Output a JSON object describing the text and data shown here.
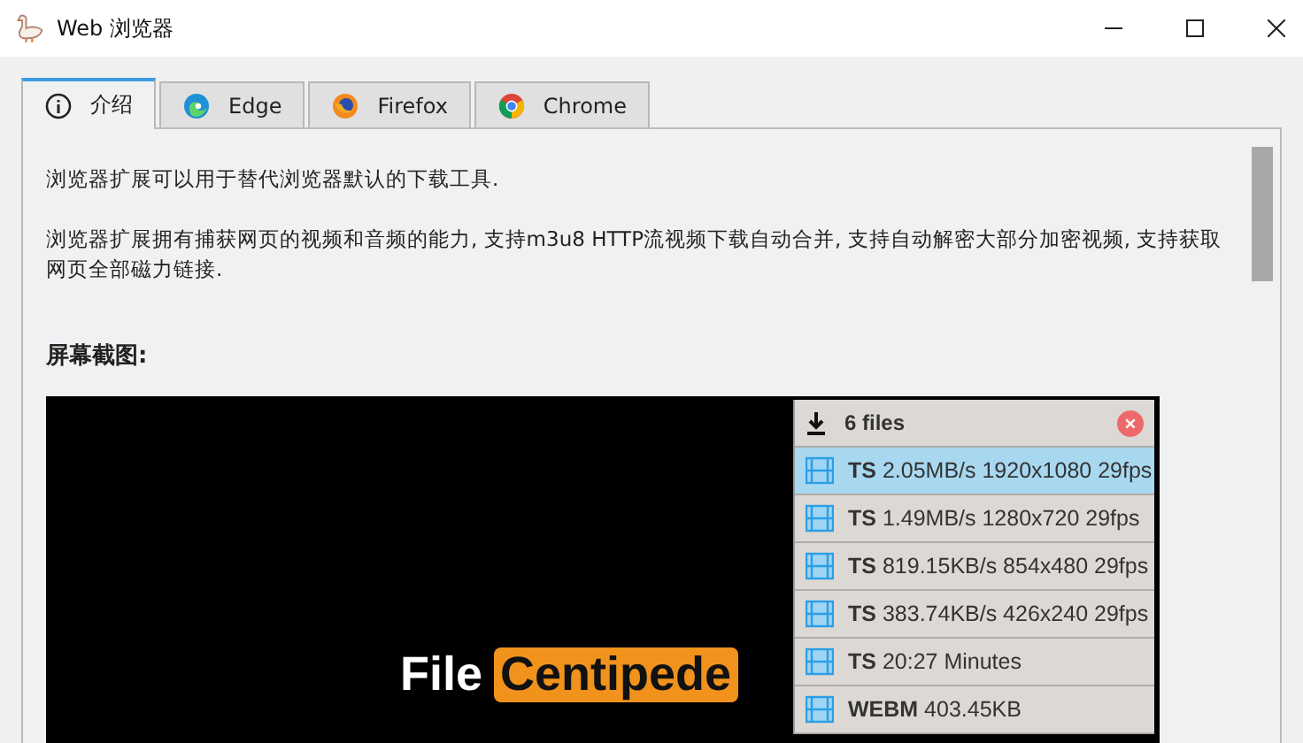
{
  "window": {
    "title": "Web 浏览器"
  },
  "tabs": [
    {
      "label": "介绍",
      "kind": "info",
      "selected": true
    },
    {
      "label": "Edge",
      "kind": "edge",
      "selected": false
    },
    {
      "label": "Firefox",
      "kind": "firefox",
      "selected": false
    },
    {
      "label": "Chrome",
      "kind": "chrome",
      "selected": false
    }
  ],
  "paragraphs": [
    "浏览器扩展可以用于替代浏览器默认的下载工具.",
    "浏览器扩展拥有捕获网页的视频和音频的能力, 支持m3u8 HTTP流视频下载自动合并, 支持自动解密大部分加密视频, 支持获取网页全部磁力链接."
  ],
  "section_heading": "屏幕截图:",
  "screenshot": {
    "logo_word": "File",
    "logo_highlight": "Centipede",
    "panel_title": "6 files",
    "files": [
      {
        "format": "TS",
        "detail": "2.05MB/s 1920x1080 29fps",
        "selected": true
      },
      {
        "format": "TS",
        "detail": "1.49MB/s 1280x720 29fps",
        "selected": false
      },
      {
        "format": "TS",
        "detail": "819.15KB/s 854x480 29fps",
        "selected": false
      },
      {
        "format": "TS",
        "detail": "383.74KB/s 426x240 29fps",
        "selected": false
      },
      {
        "format": "TS",
        "detail": "20:27 Minutes",
        "selected": false
      },
      {
        "format": "WEBM",
        "detail": "403.45KB",
        "selected": false
      }
    ]
  }
}
